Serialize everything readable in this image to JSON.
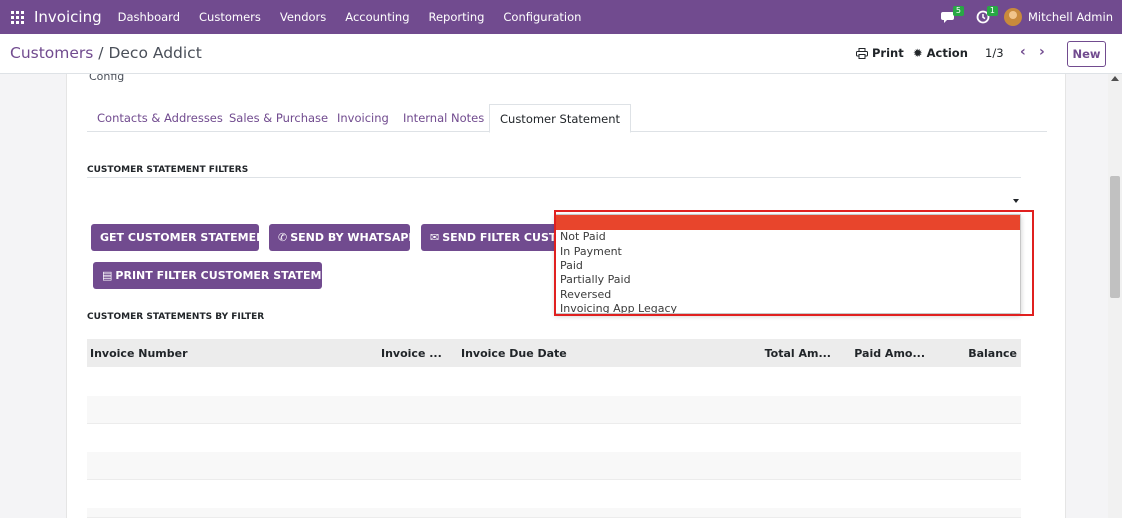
{
  "navbar": {
    "brand": "Invoicing",
    "menu": [
      "Dashboard",
      "Customers",
      "Vendors",
      "Accounting",
      "Reporting",
      "Configuration"
    ],
    "messages_count": "5",
    "activities_count": "1",
    "user_name": "Mitchell Admin",
    "accent": "#714b8f"
  },
  "control_panel": {
    "breadcrumb_parent": "Customers",
    "breadcrumb_separator": " / ",
    "breadcrumb_current": "Deco Addict",
    "print_label": "Print",
    "action_label": "Action",
    "pager": "1/3",
    "new_label": "New"
  },
  "form": {
    "config_text": "Config",
    "tabs": [
      "Contacts & Addresses",
      "Sales & Purchase",
      "Invoicing",
      "Internal Notes",
      "Customer Statement"
    ],
    "active_tab": "Customer Statement",
    "filters_title": "CUSTOMER STATEMENT FILTERS",
    "buttons": {
      "get_statement": "GET CUSTOMER STATEMENT",
      "send_whatsapp": "SEND BY WHATSAPP",
      "send_filter": "SEND FILTER CUSTOMER STATEMENT",
      "print_filter": "PRINT FILTER CUSTOMER STATEMENT"
    },
    "dropdown_options": [
      "Not Paid",
      "In Payment",
      "Paid",
      "Partially Paid",
      "Reversed",
      "Invoicing App Legacy"
    ],
    "by_filter_title": "CUSTOMER STATEMENTS BY FILTER",
    "table_columns": [
      "Invoice Number",
      "Invoice ...",
      "Invoice Due Date",
      "Total Am...",
      "Paid Amo...",
      "Balance"
    ]
  }
}
